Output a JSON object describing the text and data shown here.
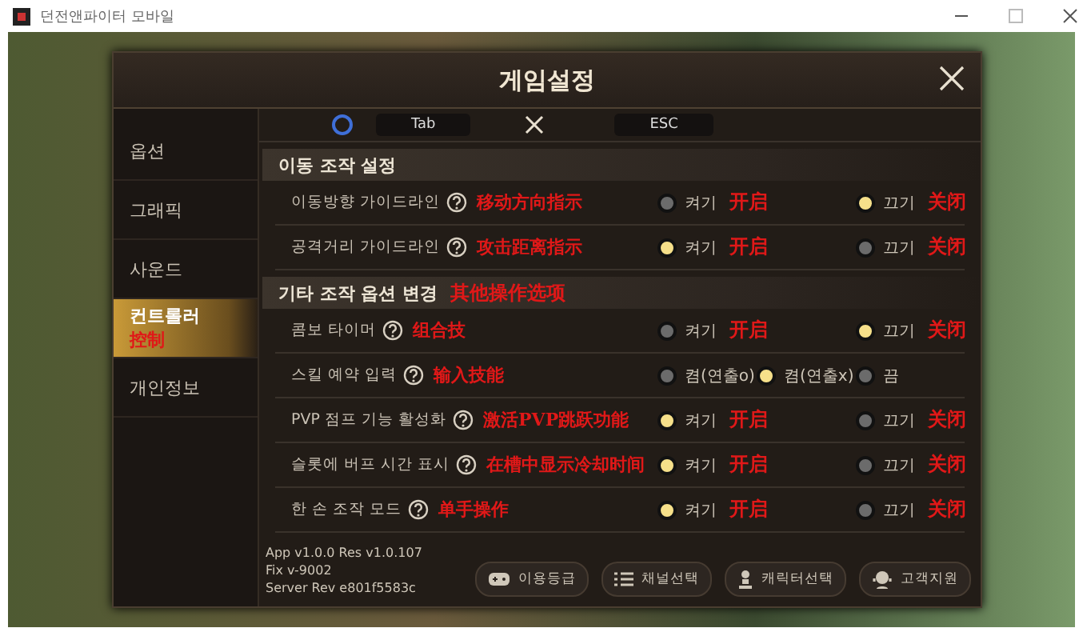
{
  "window": {
    "title": "던전앤파이터 모바일"
  },
  "dialog": {
    "title": "게임설정"
  },
  "top_strip": {
    "keys": [
      "Tab",
      "ESC"
    ]
  },
  "sidebar": {
    "items": [
      {
        "label": "옵션",
        "selected": false
      },
      {
        "label": "그래픽",
        "selected": false
      },
      {
        "label": "사운드",
        "selected": false
      },
      {
        "label": "컨트롤러",
        "annotation": "控制",
        "selected": true
      },
      {
        "label": "개인정보",
        "selected": false
      }
    ]
  },
  "sections": [
    {
      "title": "이동 조작 설정",
      "rows": [
        {
          "label": "이동방향 가이드라인",
          "annotation": "移动方向指示",
          "options": [
            {
              "label": "켜기",
              "annotation": "开启",
              "selected": false
            },
            {
              "label": "끄기",
              "annotation": "关闭",
              "selected": true
            }
          ]
        },
        {
          "label": "공격거리 가이드라인",
          "annotation": "攻击距离指示",
          "options": [
            {
              "label": "켜기",
              "annotation": "开启",
              "selected": true
            },
            {
              "label": "끄기",
              "annotation": "关闭",
              "selected": false
            }
          ]
        }
      ]
    },
    {
      "title": "기타 조작 옵션 변경",
      "annotation": "其他操作选项",
      "rows": [
        {
          "label": "콤보 타이머",
          "annotation": "组合技",
          "options": [
            {
              "label": "켜기",
              "annotation": "开启",
              "selected": false
            },
            {
              "label": "끄기",
              "annotation": "关闭",
              "selected": true
            }
          ]
        },
        {
          "label": "스킬 예약 입력",
          "annotation": "输入技能",
          "options": [
            {
              "label": "켬(연출o)",
              "selected": false
            },
            {
              "label": "켬(연출x)",
              "selected": true
            },
            {
              "label": "끔",
              "selected": false
            }
          ]
        },
        {
          "label": "PVP 점프 기능 활성화",
          "annotation": "激活PVP跳跃功能",
          "options": [
            {
              "label": "켜기",
              "annotation": "开启",
              "selected": true
            },
            {
              "label": "끄기",
              "annotation": "关闭",
              "selected": false
            }
          ]
        },
        {
          "label": "슬롯에 버프 시간 표시",
          "annotation": "在槽中显示冷却时间",
          "options": [
            {
              "label": "켜기",
              "annotation": "开启",
              "selected": true
            },
            {
              "label": "끄기",
              "annotation": "关闭",
              "selected": false
            }
          ]
        },
        {
          "label": "한 손 조작 모드",
          "annotation": "单手操作",
          "options": [
            {
              "label": "켜기",
              "annotation": "开启",
              "selected": true
            },
            {
              "label": "끄기",
              "annotation": "关闭",
              "selected": false
            }
          ]
        }
      ]
    }
  ],
  "version_lines": [
    "App v1.0.0 Res v1.0.107",
    "Fix v-9002",
    "Server Rev e801f5583c"
  ],
  "footer_buttons": [
    {
      "label": "이용등급",
      "kind": "gamepad"
    },
    {
      "label": "채널선택",
      "kind": "list"
    },
    {
      "label": "캐릭터선택",
      "kind": "person"
    },
    {
      "label": "고객지원",
      "kind": "support"
    }
  ]
}
